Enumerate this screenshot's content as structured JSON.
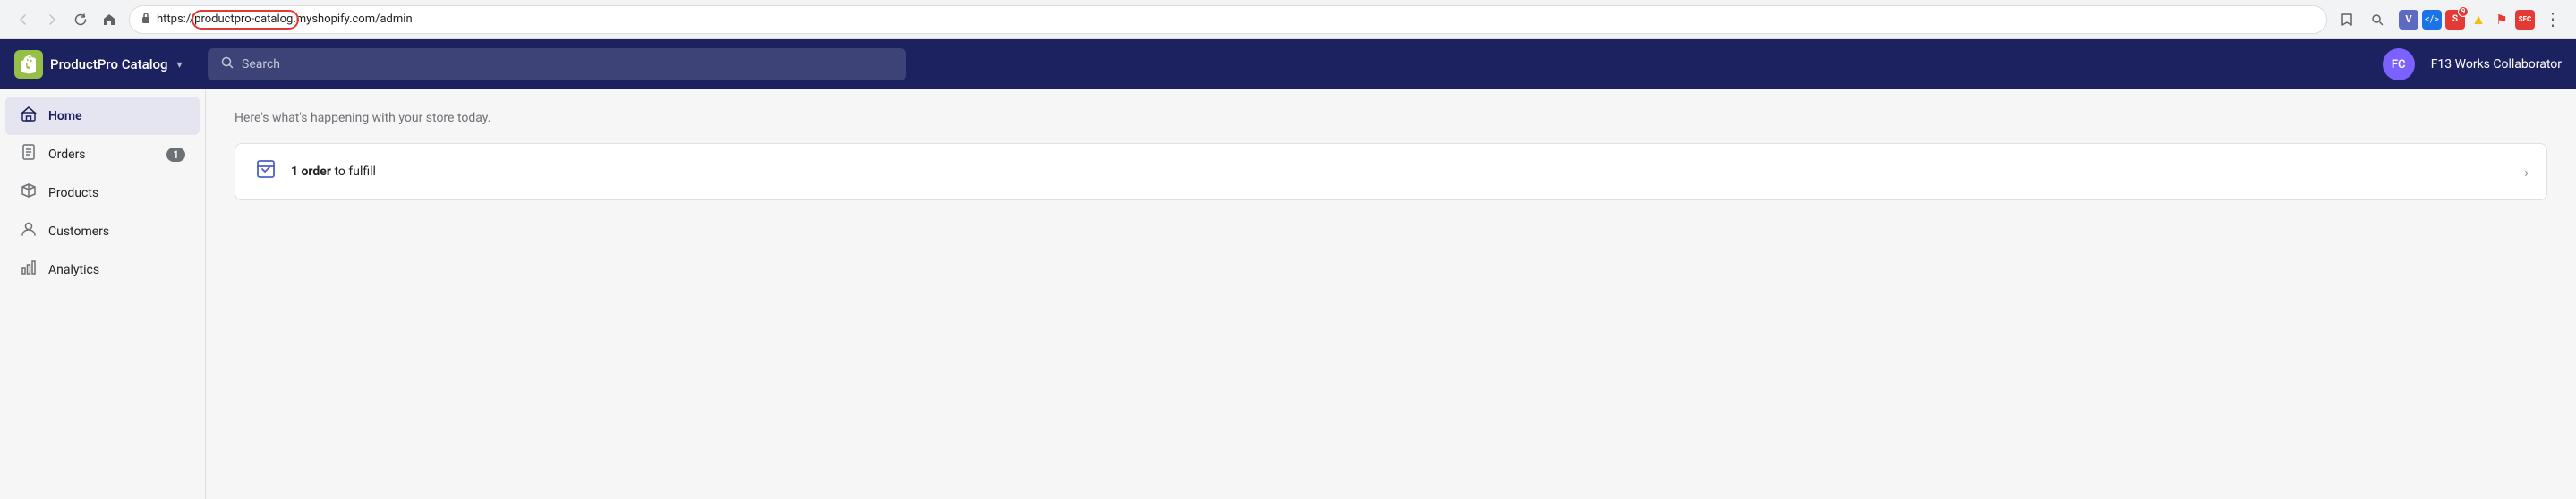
{
  "browser": {
    "url_protocol": "https://",
    "url_highlight": "productpro-catalog.",
    "url_domain": "myshopify.com",
    "url_path": "/admin",
    "back_btn": "←",
    "forward_btn": "→",
    "reload_btn": "↻",
    "home_btn": "⌂"
  },
  "topnav": {
    "store_name": "ProductPro Catalog",
    "search_placeholder": "Search",
    "user_initials": "FC",
    "user_name": "F13 Works Collaborator"
  },
  "sidebar": {
    "items": [
      {
        "label": "Home",
        "icon": "home",
        "active": true,
        "badge": null
      },
      {
        "label": "Orders",
        "icon": "orders",
        "active": false,
        "badge": "1"
      },
      {
        "label": "Products",
        "icon": "products",
        "active": false,
        "badge": null
      },
      {
        "label": "Customers",
        "icon": "customers",
        "active": false,
        "badge": null
      },
      {
        "label": "Analytics",
        "icon": "analytics",
        "active": false,
        "badge": null
      }
    ]
  },
  "content": {
    "subtitle": "Here's what's happening with your store today.",
    "cards": [
      {
        "icon": "fulfill",
        "text_prefix": "",
        "text_bold": "1 order",
        "text_suffix": " to fulfill"
      }
    ]
  }
}
